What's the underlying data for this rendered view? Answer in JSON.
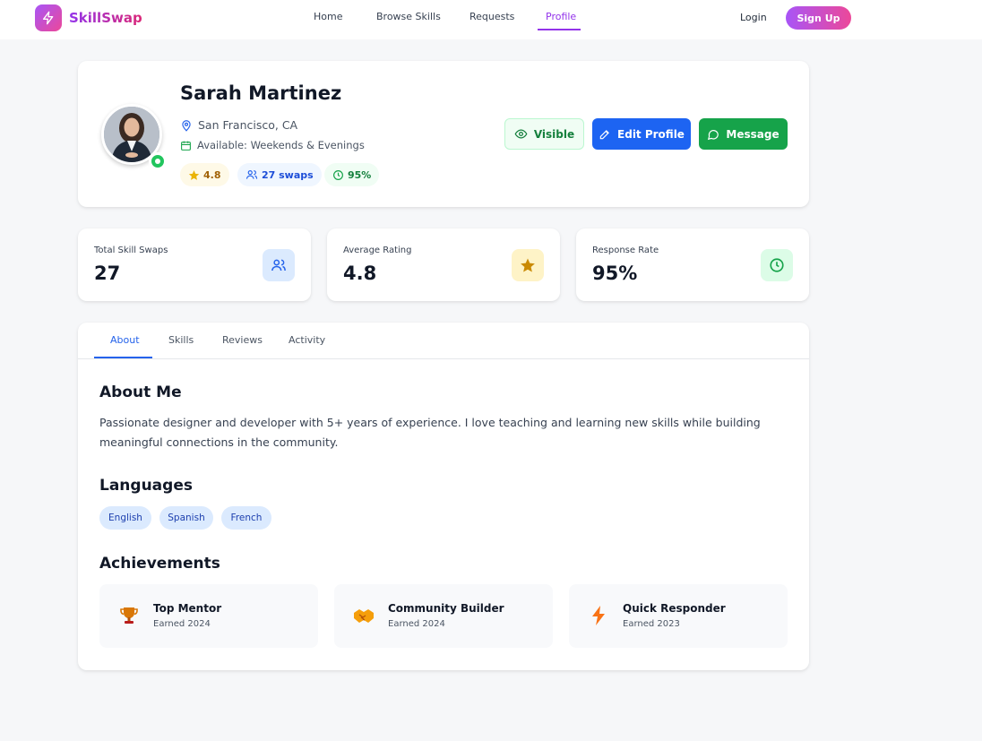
{
  "app": {
    "name": "SkillSwap",
    "logo_icon": "lightning-icon",
    "brand_gradient": [
      "#a855f7",
      "#ec4899"
    ]
  },
  "nav": {
    "links": [
      {
        "label": "Home",
        "active": false
      },
      {
        "label": "Browse Skills",
        "active": false
      },
      {
        "label": "Requests",
        "active": false
      },
      {
        "label": "Profile",
        "active": true
      }
    ],
    "login": "Login",
    "signup": "Sign Up"
  },
  "profile": {
    "name": "Sarah Martinez",
    "location": "San Francisco, CA",
    "availability": "Available: Weekends & Evenings",
    "online": true,
    "chips": {
      "rating": "4.8",
      "swaps": "27 swaps",
      "response": "95%"
    },
    "buttons": {
      "visible": "Visible",
      "edit": "Edit Profile",
      "message": "Message"
    }
  },
  "stats": [
    {
      "label": "Total Skill Swaps",
      "value": "27",
      "icon": "users-icon",
      "color": "#2563eb"
    },
    {
      "label": "Average Rating",
      "value": "4.8",
      "icon": "star-icon",
      "color": "#ca8a04"
    },
    {
      "label": "Response Rate",
      "value": "95%",
      "icon": "clock-icon",
      "color": "#16a34a"
    }
  ],
  "tabs": [
    {
      "label": "About",
      "active": true
    },
    {
      "label": "Skills",
      "active": false
    },
    {
      "label": "Reviews",
      "active": false
    },
    {
      "label": "Activity",
      "active": false
    }
  ],
  "about": {
    "title": "About Me",
    "text": "Passionate designer and developer with 5+ years of experience. I love teaching and learning new skills while building meaningful connections in the community."
  },
  "languages": {
    "title": "Languages",
    "items": [
      "English",
      "Spanish",
      "French"
    ]
  },
  "achievements": {
    "title": "Achievements",
    "items": [
      {
        "title": "Top Mentor",
        "date": "Earned 2024",
        "icon": "trophy-icon"
      },
      {
        "title": "Community Builder",
        "date": "Earned 2024",
        "icon": "handshake-icon"
      },
      {
        "title": "Quick Responder",
        "date": "Earned 2023",
        "icon": "lightning-icon"
      }
    ]
  }
}
